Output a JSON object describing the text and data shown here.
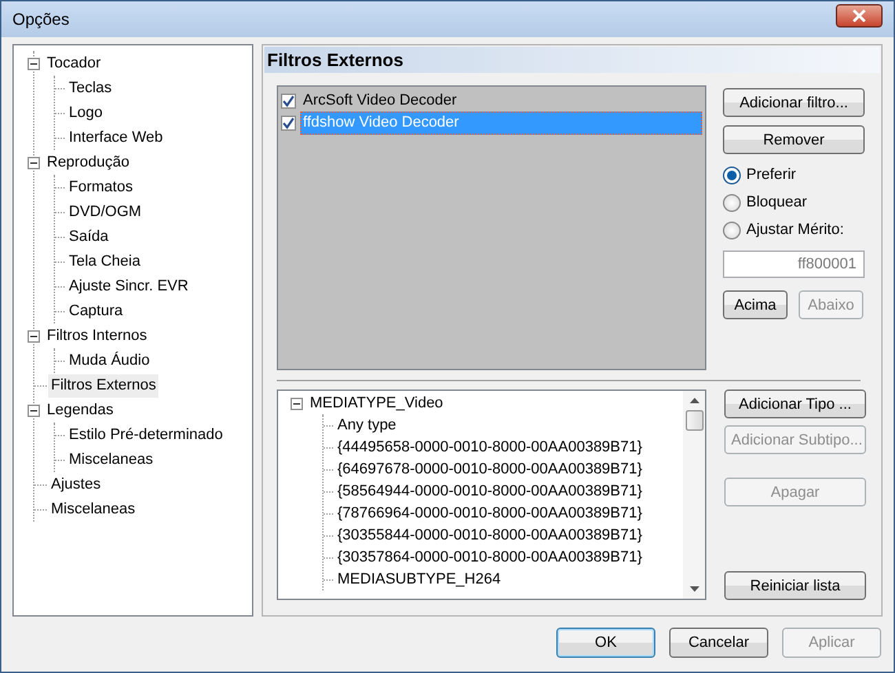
{
  "window": {
    "title": "Opções"
  },
  "nav_tree": [
    {
      "label": "Tocador",
      "expanded": true,
      "selected": false,
      "children": [
        {
          "label": "Teclas",
          "selected": false
        },
        {
          "label": "Logo",
          "selected": false
        },
        {
          "label": "Interface Web",
          "selected": false
        }
      ]
    },
    {
      "label": "Reprodução",
      "expanded": true,
      "selected": false,
      "children": [
        {
          "label": "Formatos",
          "selected": false
        },
        {
          "label": "DVD/OGM",
          "selected": false
        },
        {
          "label": "Saída",
          "selected": false
        },
        {
          "label": "Tela Cheia",
          "selected": false
        },
        {
          "label": "Ajuste Sincr. EVR",
          "selected": false
        },
        {
          "label": "Captura",
          "selected": false
        }
      ]
    },
    {
      "label": "Filtros Internos",
      "expanded": true,
      "selected": false,
      "children": [
        {
          "label": "Muda Áudio",
          "selected": false
        }
      ]
    },
    {
      "label": "Filtros Externos",
      "selected": true
    },
    {
      "label": "Legendas",
      "expanded": true,
      "selected": false,
      "children": [
        {
          "label": "Estilo Pré-determinado",
          "selected": false
        },
        {
          "label": "Miscelaneas",
          "selected": false
        }
      ]
    },
    {
      "label": "Ajustes",
      "selected": false
    },
    {
      "label": "Miscelaneas",
      "selected": false
    }
  ],
  "page": {
    "title": "Filtros Externos"
  },
  "filters": [
    {
      "label": "ArcSoft Video Decoder",
      "checked": true,
      "selected": false
    },
    {
      "label": "ffdshow Video Decoder",
      "checked": true,
      "selected": true
    }
  ],
  "filter_buttons": [
    {
      "label": "Adicionar filtro...",
      "disabled": false
    },
    {
      "label": "Remover",
      "disabled": false
    }
  ],
  "merit_options": [
    {
      "label": "Preferir",
      "selected": true
    },
    {
      "label": "Bloquear",
      "selected": false
    },
    {
      "label": "Ajustar Mérito:",
      "selected": false
    }
  ],
  "merit_field": {
    "value": "ff800001",
    "disabled": true
  },
  "order_buttons": [
    {
      "label": "Acima",
      "disabled": false
    },
    {
      "label": "Abaixo",
      "disabled": true
    }
  ],
  "type_tree": [
    {
      "label": "MEDIATYPE_Video",
      "expanded": true,
      "children": [
        {
          "label": "Any type"
        },
        {
          "label": "{44495658-0000-0010-8000-00AA00389B71}"
        },
        {
          "label": "{64697678-0000-0010-8000-00AA00389B71}"
        },
        {
          "label": "{58564944-0000-0010-8000-00AA00389B71}"
        },
        {
          "label": "{78766964-0000-0010-8000-00AA00389B71}"
        },
        {
          "label": "{30355844-0000-0010-8000-00AA00389B71}"
        },
        {
          "label": "{30357864-0000-0010-8000-00AA00389B71}"
        },
        {
          "label": "MEDIASUBTYPE_H264"
        }
      ]
    }
  ],
  "type_buttons": [
    {
      "label": "Adicionar Tipo ...",
      "disabled": false
    },
    {
      "label": "Adicionar Subtipo...",
      "disabled": true
    },
    {
      "label": "Apagar",
      "disabled": true
    }
  ],
  "reset_button": {
    "label": "Reiniciar lista",
    "disabled": false
  },
  "dialog_buttons": [
    {
      "label": "OK",
      "disabled": false,
      "default": true
    },
    {
      "label": "Cancelar",
      "disabled": false,
      "default": false
    },
    {
      "label": "Aplicar",
      "disabled": true,
      "default": false
    }
  ]
}
